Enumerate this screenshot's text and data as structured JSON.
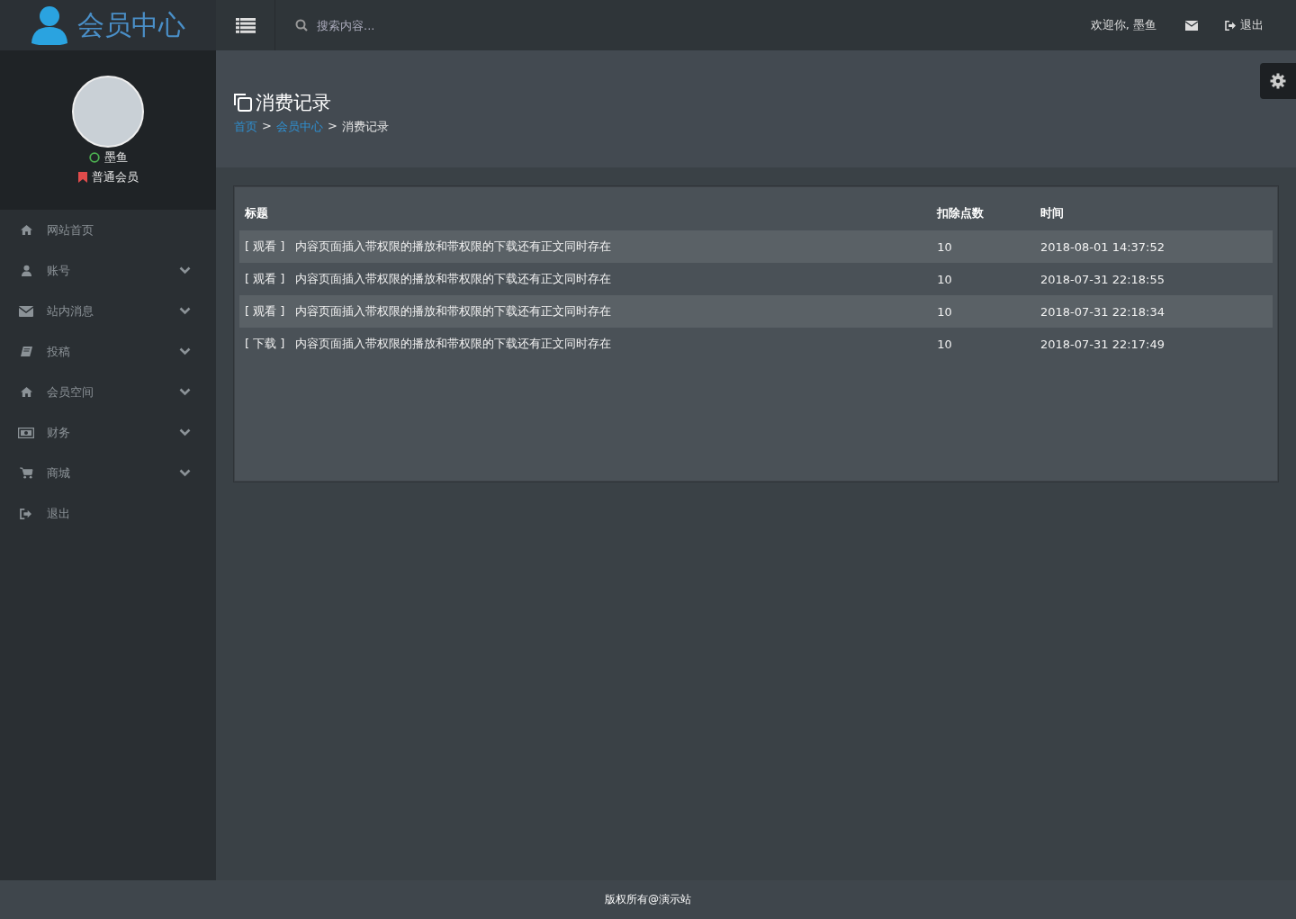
{
  "header": {
    "logo_text": "会员中心",
    "search": {
      "placeholder": "搜索内容..."
    },
    "welcome": "欢迎你, 墨鱼",
    "logout": "退出"
  },
  "profile": {
    "name": "墨鱼",
    "level": "普通会员"
  },
  "sidebar": {
    "items": [
      {
        "label": "网站首页",
        "kind": "home",
        "has_submenu": false
      },
      {
        "label": "账号",
        "kind": "user",
        "has_submenu": true
      },
      {
        "label": "站内消息",
        "kind": "mail",
        "has_submenu": true
      },
      {
        "label": "投稿",
        "kind": "book",
        "has_submenu": true
      },
      {
        "label": "会员空间",
        "kind": "home",
        "has_submenu": true
      },
      {
        "label": "财务",
        "kind": "money",
        "has_submenu": true
      },
      {
        "label": "商城",
        "kind": "cart",
        "has_submenu": true
      },
      {
        "label": "退出",
        "kind": "signout",
        "has_submenu": false
      }
    ]
  },
  "page": {
    "title": "消费记录",
    "breadcrumb": [
      {
        "label": "首页",
        "link": true
      },
      {
        "label": "会员中心",
        "link": true
      },
      {
        "label": "消费记录",
        "link": false
      }
    ],
    "separator": ">"
  },
  "table": {
    "columns": [
      "标题",
      "扣除点数",
      "时间"
    ],
    "rows": [
      {
        "tag": "[ 观看 ]",
        "title": "内容页面插入带权限的播放和带权限的下载还有正文同时存在",
        "points": "10",
        "time": "2018-08-01 14:37:52"
      },
      {
        "tag": "[ 观看 ]",
        "title": "内容页面插入带权限的播放和带权限的下载还有正文同时存在",
        "points": "10",
        "time": "2018-07-31 22:18:55"
      },
      {
        "tag": "[ 观看 ]",
        "title": "内容页面插入带权限的播放和带权限的下载还有正文同时存在",
        "points": "10",
        "time": "2018-07-31 22:18:34"
      },
      {
        "tag": "[ 下载 ]",
        "title": "内容页面插入带权限的播放和带权限的下载还有正文同时存在",
        "points": "10",
        "time": "2018-07-31 22:17:49"
      }
    ]
  },
  "footer": "版权所有@演示站"
}
